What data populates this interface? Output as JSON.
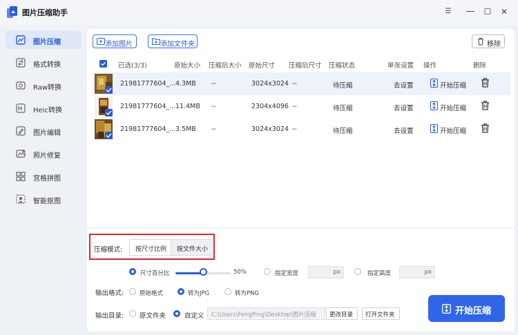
{
  "app": {
    "title": "图片压缩助手"
  },
  "window": {
    "minimize": "—",
    "restore": "☐",
    "close": "✕"
  },
  "sidebar": {
    "items": [
      {
        "label": "图片压缩",
        "icon": "image-compress-icon",
        "active": true
      },
      {
        "label": "格式转换",
        "icon": "format-convert-icon",
        "active": false
      },
      {
        "label": "Raw转换",
        "icon": "raw-icon",
        "active": false
      },
      {
        "label": "Heic转换",
        "icon": "heic-icon",
        "active": false
      },
      {
        "label": "图片编辑",
        "icon": "edit-icon",
        "active": false
      },
      {
        "label": "照片修复",
        "icon": "repair-icon",
        "active": false
      },
      {
        "label": "宫格拼图",
        "icon": "grid-icon",
        "active": false
      },
      {
        "label": "智能抠图",
        "icon": "cutout-icon",
        "active": false
      }
    ]
  },
  "toolbar": {
    "add_image": "添加图片",
    "add_folder": "添加文件夹",
    "remove": "移除"
  },
  "table": {
    "headers": {
      "selected": "已选(3/3)",
      "orig_size": "原始大小",
      "comp_size": "压缩后大小",
      "orig_dim": "原始尺寸",
      "comp_dim": "压缩后尺寸",
      "status": "压缩状态",
      "single": "单张设置",
      "action": "操作",
      "delete": "删除"
    },
    "rows": [
      {
        "name": "21981777604_...",
        "orig_size": "4.3MB",
        "comp_size": "--",
        "orig_dim": "3024x3024",
        "comp_dim": "--",
        "status": "待压缩",
        "set": "去设置",
        "action": "开始压缩"
      },
      {
        "name": "21981777604_...",
        "orig_size": "11.4MB",
        "comp_size": "--",
        "orig_dim": "2304x4096",
        "comp_dim": "--",
        "status": "待压缩",
        "set": "去设置",
        "action": "开始压缩"
      },
      {
        "name": "21981777604_...",
        "orig_size": "3.5MB",
        "comp_size": "--",
        "orig_dim": "3024x3024",
        "comp_dim": "--",
        "status": "待压缩",
        "set": "去设置",
        "action": "开始压缩"
      }
    ]
  },
  "settings": {
    "mode_label": "压缩模式:",
    "mode_tabs": [
      "按尺寸比例",
      "按文件大小"
    ],
    "size_percent_label": "尺寸百分比",
    "size_percent_value": "50%",
    "size_percent": 50,
    "fixed_width_label": "指定宽度",
    "fixed_height_label": "指定高度",
    "px_unit": "px",
    "format_label": "输出格式:",
    "formats": [
      "原始格式",
      "转为JPG",
      "转为PNG"
    ],
    "selected_format": "转为JPG",
    "dir_label": "输出目录:",
    "dir_options": [
      "原文件夹",
      "自定义"
    ],
    "selected_dir": "自定义",
    "dir_path": "C:\\Users\\FengPing\\Desktop\\图片压缩",
    "change_dir": "更改目录",
    "open_folder": "打开文件夹",
    "start": "开始压缩"
  },
  "colors": {
    "accent": "#2a5bd7",
    "highlight": "#d8282d"
  }
}
